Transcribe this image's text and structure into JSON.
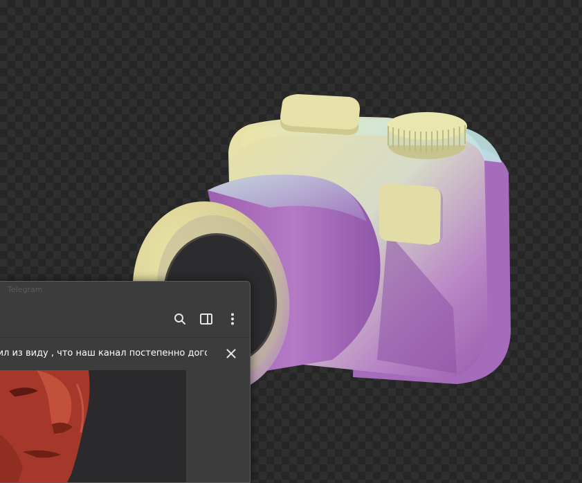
{
  "window": {
    "title": "Telegram"
  },
  "toolbar": {
    "icons": [
      "search-icon",
      "sidebar-toggle-icon",
      "more-vertical-icon"
    ]
  },
  "pinned": {
    "text": "тил из виду , что наш канал постепенно дого..."
  },
  "colors": {
    "camera_purple": "#a66cbc",
    "camera_cream": "#e8e2a6",
    "camera_cyan": "#bde6e6",
    "window_bg": "#3c3c3c",
    "face_red": "#b8402d"
  }
}
